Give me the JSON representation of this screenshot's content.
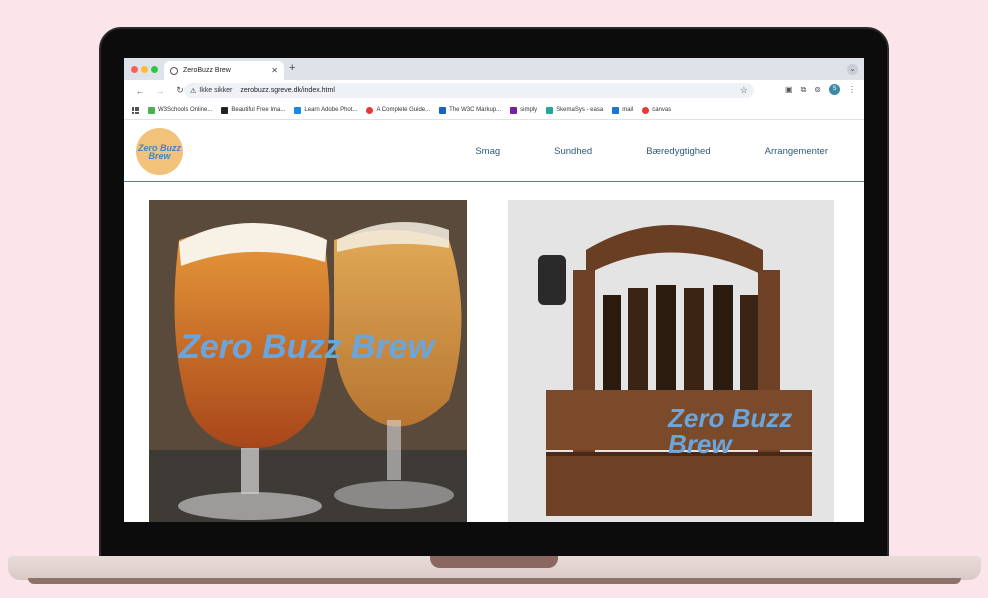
{
  "browser": {
    "tab_title": "ZeroBuzz Brew",
    "new_tab_label": "+",
    "security_label": "Ikke sikker",
    "url": "zerobuzz.sgreve.dk/index.html",
    "traffic_colors": [
      "#ff5f57",
      "#febc2e",
      "#28c840"
    ],
    "bookmarks": [
      {
        "label": "W3Schools Online...",
        "color": "#4caf50"
      },
      {
        "label": "Beautiful Free Ima...",
        "color": "#222222"
      },
      {
        "label": "Learn Adobe Phot...",
        "color": "#1e88e5"
      },
      {
        "label": "A Complete Guide...",
        "color": "#e53935"
      },
      {
        "label": "The W3C Markup...",
        "color": "#1565c0"
      },
      {
        "label": "simply",
        "color": "#7b1fa2"
      },
      {
        "label": "SkemaSys - easa",
        "color": "#26a69a"
      },
      {
        "label": "mail",
        "color": "#1976d2"
      },
      {
        "label": "canvas",
        "color": "#e53935"
      }
    ],
    "profile_initial": "S"
  },
  "site": {
    "logo_text": "Zero Buzz Brew",
    "nav": [
      "Smag",
      "Sundhed",
      "Bæredygtighed",
      "Arrangementer"
    ],
    "image1_watermark": "Zero Buzz Brew",
    "image2_watermark": "Zero Buzz Brew"
  },
  "colors": {
    "page_bg": "#fbe5ea",
    "nav_text": "#2f5a7a",
    "logo_bg": "#f2c27a",
    "brand_blue": "#6aa6dd"
  }
}
